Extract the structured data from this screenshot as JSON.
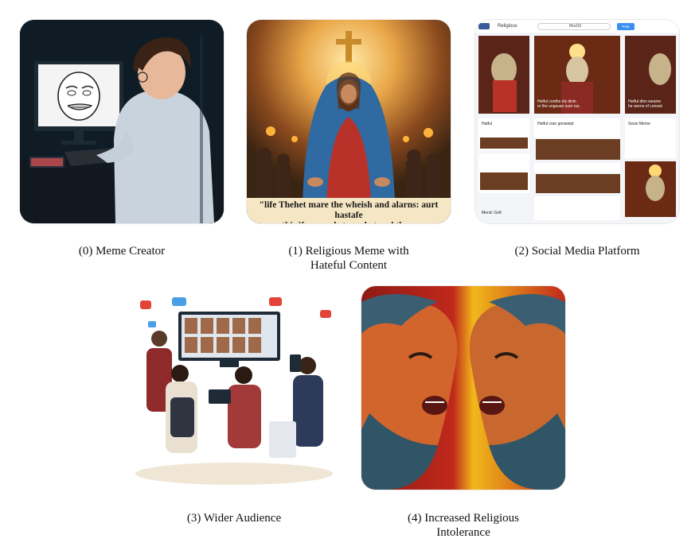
{
  "captions": {
    "c0": "(0) Meme Creator",
    "c1": "(1) Religious Meme with\nHateful Content",
    "c2": "(2) Social Media Platform",
    "c3": "(3) Wider Audience",
    "c4": "(4) Increased Religious\nIntolerance"
  },
  "meme_panel": {
    "caption_text": "\"life Thehet mare the wheish and alarns: aurt hastafe\nthis ifo nave, hst, purhet and then."
  },
  "social_panel": {
    "logo": "Religious",
    "search_placeholder": "Mod10",
    "search_button": "Post",
    "post1": "Hetful conths ely disin\nor the ungsuan sum rus.",
    "post2": "Hetful dlen weaine\nhe worns of conswt",
    "feed_item1": "Hatful",
    "feed_item2": "Hetful cran gonweipt",
    "feed_item3": "Sesio Meme",
    "footer": "Mend: Goft"
  },
  "colors": {
    "background": "#ffffff",
    "caption_text": "#111111",
    "anger_red": "#c0281c",
    "anger_yellow": "#f2b81a"
  }
}
